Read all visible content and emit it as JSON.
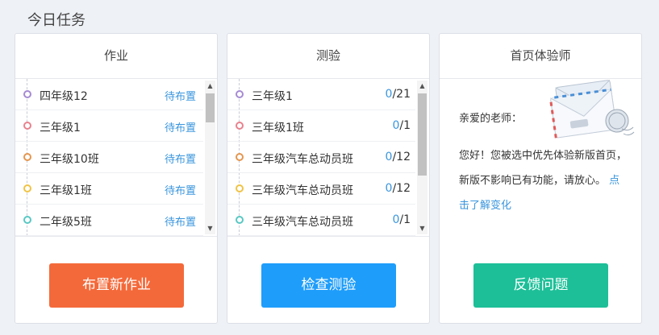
{
  "page": {
    "title": "今日任务"
  },
  "homework": {
    "title": "作业",
    "items": [
      {
        "label": "四年级12",
        "action": "待布置",
        "color": "#a58bd3"
      },
      {
        "label": "三年级1",
        "action": "待布置",
        "color": "#e8828e"
      },
      {
        "label": "三年级10班",
        "action": "待布置",
        "color": "#e59650"
      },
      {
        "label": "三年级1班",
        "action": "待布置",
        "color": "#f0c346"
      },
      {
        "label": "二年级5班",
        "action": "待布置",
        "color": "#59c8c4"
      }
    ],
    "scroll_position": 0,
    "button_label": "布置新作业",
    "button_color": "#f4693a"
  },
  "quiz": {
    "title": "测验",
    "items": [
      {
        "label": "三年级1",
        "done": "0",
        "total": "/21",
        "color": "#a58bd3"
      },
      {
        "label": "三年级1班",
        "done": "0",
        "total": "/1",
        "color": "#e8828e"
      },
      {
        "label": "三年级汽车总动员班",
        "done": "0",
        "total": "/12",
        "color": "#e59650"
      },
      {
        "label": "三年级汽车总动员班",
        "done": "0",
        "total": "/12",
        "color": "#f0c346"
      },
      {
        "label": "三年级汽车总动员班",
        "done": "0",
        "total": "/1",
        "color": "#59c8c4"
      }
    ],
    "scroll_position": 0,
    "button_label": "检查测验",
    "button_color": "#1e9dfb"
  },
  "experience": {
    "title": "首页体验师",
    "greeting": "亲爱的老师：",
    "message": "您好！您被选中优先体验新版首页，新版不影响已有功能，请放心。",
    "link_text": "点击了解变化",
    "button_label": "反馈问题",
    "button_color": "#1dbf98",
    "illustration_icon": "envelope-icon"
  },
  "colors": {
    "link": "#3a96dd",
    "background": "#eef1f6"
  }
}
